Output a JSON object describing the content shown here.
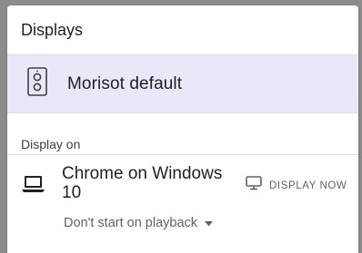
{
  "dialog": {
    "title": "Displays"
  },
  "selected_device": {
    "label": "Morisot default",
    "icon": "speaker-icon"
  },
  "display_on": {
    "heading": "Display on",
    "items": [
      {
        "name": "Chrome on Windows 10",
        "icon": "laptop-icon",
        "action_label": "DISPLAY NOW",
        "action_icon": "monitor-icon",
        "start_option": "Don't start on playback"
      }
    ]
  },
  "colors": {
    "selected_bg": "#e8e8f8",
    "text_primary": "#202124",
    "text_secondary": "#5f6368"
  }
}
